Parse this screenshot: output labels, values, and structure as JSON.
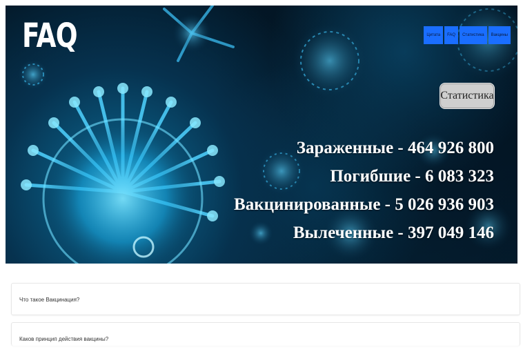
{
  "header": {
    "logo": "FAQ",
    "nav": [
      "Цитата",
      "FAQ",
      "Статистика",
      "Вакцины"
    ]
  },
  "hero": {
    "stats_button": "Статистика",
    "stats": [
      "Зараженные - 464 926 800",
      "Погибшие - 6 083 323",
      "Вакцинированные - 5 026 936 903",
      "Вылеченные - 397 049 146"
    ]
  },
  "faq": {
    "items": [
      "Что такое Вакцинация?",
      "Каков принцип действия вакцины?"
    ]
  },
  "colors": {
    "nav_bg": "#1a6eff",
    "hero_bg": "#041c2e",
    "virus_glow": "#3fc8ff"
  },
  "icons": {
    "hero_art": "virus-illustration"
  }
}
